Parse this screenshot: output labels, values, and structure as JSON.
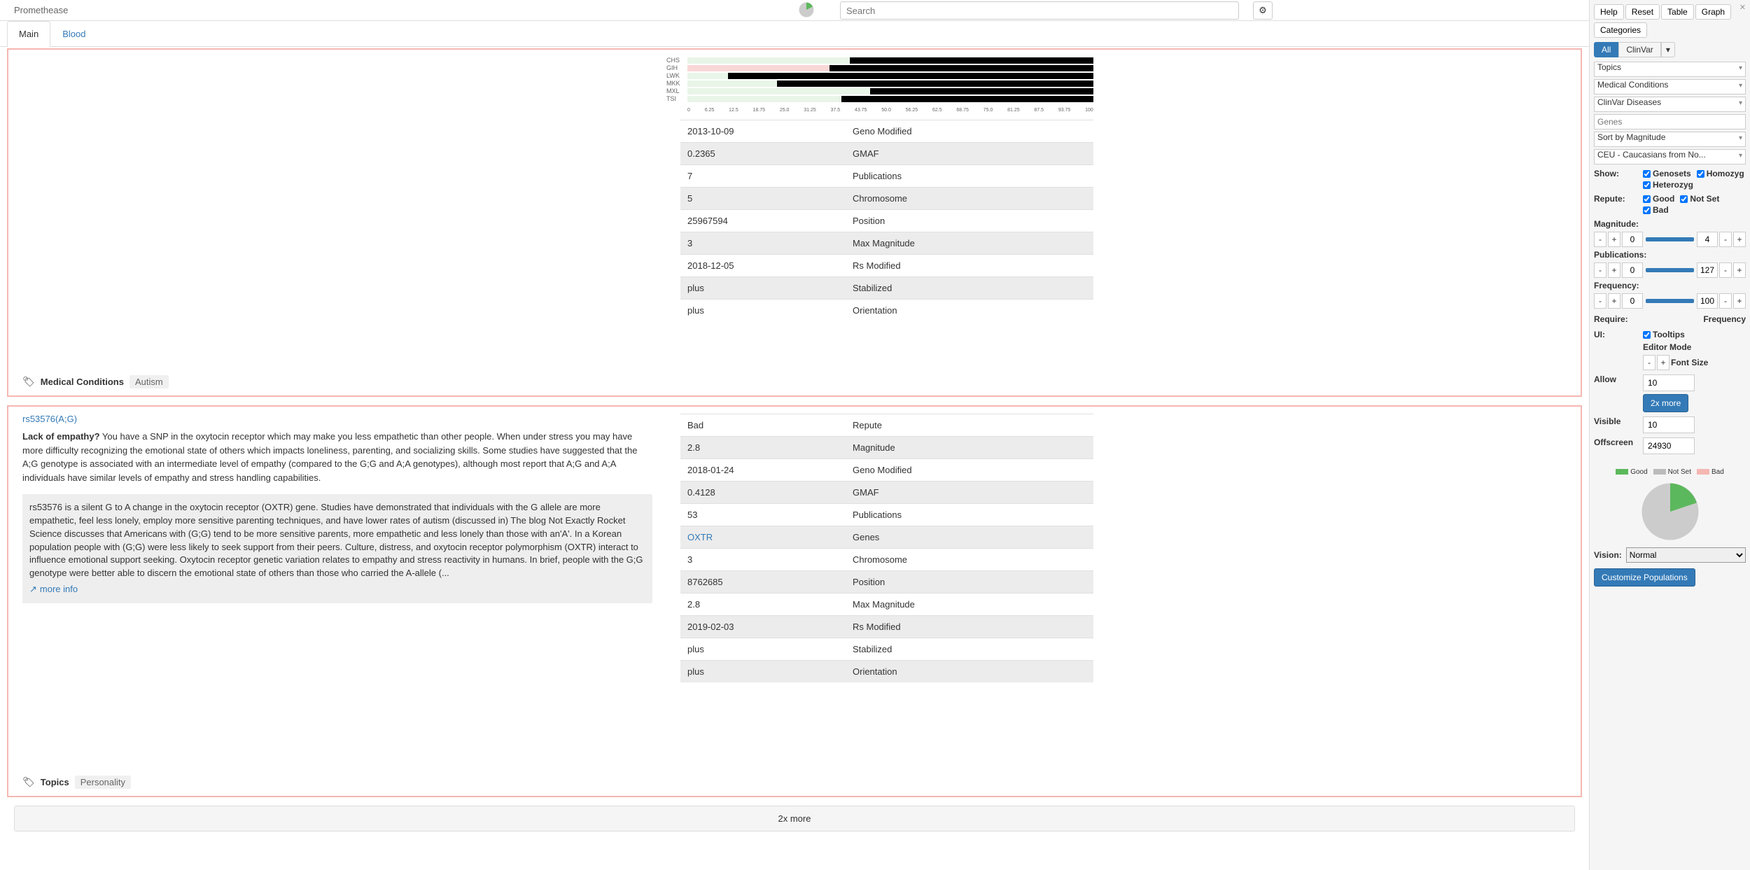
{
  "brand": "Promethease",
  "search_placeholder": "Search",
  "tabs": [
    "Main",
    "Blood"
  ],
  "load_more": "2x more",
  "card1": {
    "chart_labels": [
      "CHS",
      "GIH",
      "LWK",
      "MKK",
      "MXL",
      "TSI"
    ],
    "axis": [
      "0",
      "6.25",
      "12.5",
      "18.75",
      "25.0",
      "31.25",
      "37.5",
      "43.75",
      "50.0",
      "56.25",
      "62.5",
      "68.75",
      "75.0",
      "81.25",
      "87.5",
      "93.75",
      "100"
    ],
    "rows": [
      {
        "v": "2013-10-09",
        "k": "Geno Modified"
      },
      {
        "v": "0.2365",
        "k": "GMAF"
      },
      {
        "v": "7",
        "k": "Publications"
      },
      {
        "v": "5",
        "k": "Chromosome"
      },
      {
        "v": "25967594",
        "k": "Position"
      },
      {
        "v": "3",
        "k": "Max Magnitude"
      },
      {
        "v": "2018-12-05",
        "k": "Rs Modified"
      },
      {
        "v": "plus",
        "k": "Stabilized"
      },
      {
        "v": "plus",
        "k": "Orientation"
      }
    ],
    "tag_cat": "Medical Conditions",
    "tag_val": "Autism"
  },
  "card2": {
    "snp": "rs53576(A;G)",
    "headline": "Lack of empathy?",
    "desc": "You have a SNP in the oxytocin receptor which may make you less empathetic than other people. When under stress you may have more difficulty recognizing the emotional state of others which impacts loneliness, parenting, and socializing skills. Some studies have suggested that the A;G genotype is associated with an intermediate level of empathy (compared to the G;G and A;A genotypes), although most report that A;G and A;A individuals have similar levels of empathy and stress handling capabilities.",
    "info": "rs53576 is a silent G to A change in the oxytocin receptor (OXTR) gene. Studies have demonstrated that individuals with the G allele are more empathetic, feel less lonely, employ more sensitive parenting techniques, and have lower rates of autism (discussed in) The blog Not Exactly Rocket Science discusses that Americans with (G;G) tend to be more sensitive parents, more empathetic and less lonely than those with an'A'. In a Korean population people with (G;G) were less likely to seek support from their peers. Culture, distress, and oxytocin receptor polymorphism (OXTR) interact to influence emotional support seeking. Oxytocin receptor genetic variation relates to empathy and stress reactivity in humans. In brief, people with the G;G genotype were better able to discern the emotional state of others than those who carried the A-allele (...",
    "more_info": "more info",
    "rows": [
      {
        "v": "Bad",
        "k": "Repute"
      },
      {
        "v": "2.8",
        "k": "Magnitude"
      },
      {
        "v": "2018-01-24",
        "k": "Geno Modified"
      },
      {
        "v": "0.4128",
        "k": "GMAF"
      },
      {
        "v": "53",
        "k": "Publications"
      },
      {
        "v": "OXTR",
        "k": "Genes",
        "link": true
      },
      {
        "v": "3",
        "k": "Chromosome"
      },
      {
        "v": "8762685",
        "k": "Position"
      },
      {
        "v": "2.8",
        "k": "Max Magnitude"
      },
      {
        "v": "2019-02-03",
        "k": "Rs Modified"
      },
      {
        "v": "plus",
        "k": "Stabilized"
      },
      {
        "v": "plus",
        "k": "Orientation"
      }
    ],
    "tag_cat": "Topics",
    "tag_val": "Personality"
  },
  "sidebar": {
    "top_buttons": [
      "Help",
      "Reset",
      "Table",
      "Graph"
    ],
    "categories": "Categories",
    "pills": [
      "All",
      "ClinVar"
    ],
    "selects": [
      "Topics",
      "Medical Conditions",
      "ClinVar Diseases"
    ],
    "genes_placeholder": "Genes",
    "sort": "Sort by Magnitude",
    "pop": "CEU - Caucasians from No...",
    "show_label": "Show:",
    "show_opts": [
      "Genosets",
      "Homozyg",
      "Heterozyg"
    ],
    "repute_label": "Repute:",
    "repute_opts": [
      "Good",
      "Not Set",
      "Bad"
    ],
    "magnitude_label": "Magnitude:",
    "mag_min": "0",
    "mag_max": "4",
    "publications_label": "Publications:",
    "pub_min": "0",
    "pub_max": "127",
    "frequency_label": "Frequency:",
    "freq_min": "0",
    "freq_max": "100",
    "require": "Require:",
    "frequency": "Frequency",
    "ui_label": "UI:",
    "ui_opts": [
      "Tooltips",
      "Editor Mode",
      "Font Size"
    ],
    "allow": "Allow",
    "allow_val": "10",
    "allow_btn": "2x more",
    "visible": "Visible",
    "visible_val": "10",
    "offscreen": "Offscreen",
    "offscreen_val": "24930",
    "legend": [
      {
        "c": "#5cb85c",
        "t": "Good"
      },
      {
        "c": "#bbb",
        "t": "Not Set"
      },
      {
        "c": "#f5b7b1",
        "t": "Bad"
      }
    ],
    "vision": "Vision:",
    "vision_val": "Normal",
    "customize": "Customize Populations"
  }
}
